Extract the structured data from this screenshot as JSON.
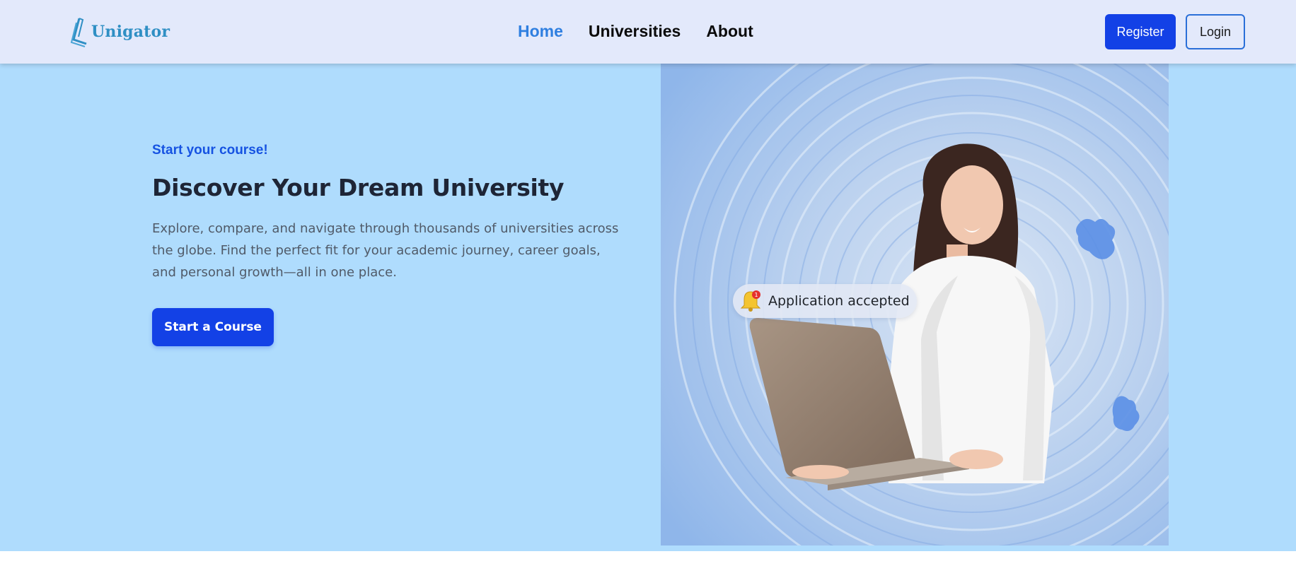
{
  "header": {
    "logo_text": "Unigator",
    "nav": [
      {
        "label": "Home",
        "active": true
      },
      {
        "label": "Universities",
        "active": false
      },
      {
        "label": "About",
        "active": false
      }
    ],
    "register_label": "Register",
    "login_label": "Login"
  },
  "hero": {
    "tagline": "Start your course!",
    "headline": "Discover Your Dream University",
    "description": "Explore, compare, and navigate through thousands of universities across the globe. Find the perfect fit for your academic journey, career goals, and personal growth—all in one place.",
    "cta_label": "Start a Course",
    "notification": {
      "icon": "bell-icon",
      "badge_count": "1",
      "text": "Application accepted"
    }
  },
  "colors": {
    "header_bg": "#e3e9fb",
    "hero_bg": "#afdcfd",
    "primary": "#1341e6",
    "active_link": "#2f7fe0",
    "tagline": "#1653e2"
  }
}
